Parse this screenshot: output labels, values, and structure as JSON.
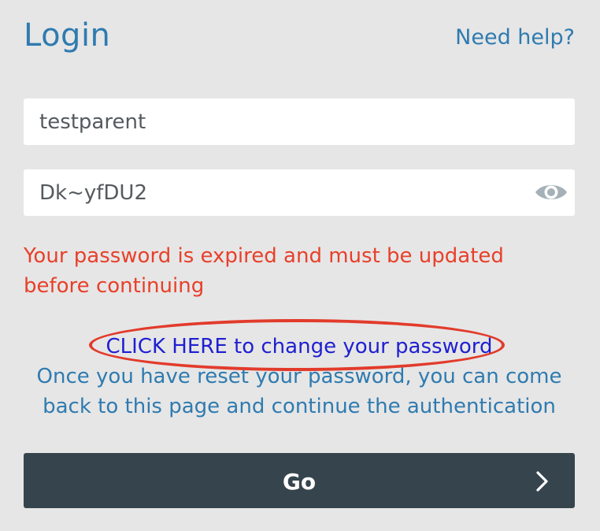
{
  "header": {
    "title": "Login",
    "help_link": "Need help?"
  },
  "form": {
    "username": {
      "value": "testparent",
      "placeholder": ""
    },
    "password": {
      "value": "Dk~yfDU2",
      "placeholder": ""
    }
  },
  "messages": {
    "error": "Your password is expired and must be updated before continuing",
    "change_link": "CLICK HERE to change your password",
    "info": "Once you have reset your password, you can come back to this page and continue the authentication"
  },
  "actions": {
    "go_label": "Go"
  },
  "icons": {
    "eye": "eye-icon",
    "chevron": "chevron-right-icon"
  },
  "colors": {
    "accent": "#2f7bb0",
    "error": "#e8402a",
    "link": "#1f1fd1",
    "annotation": "#e23b2b",
    "button": "#36454d",
    "background": "#e6e6e6"
  }
}
